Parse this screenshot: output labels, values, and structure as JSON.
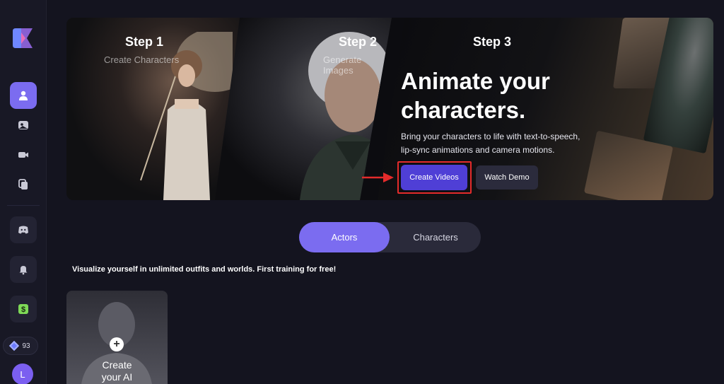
{
  "sidebar": {
    "credits": "93",
    "avatar_initial": "L",
    "items": [
      {
        "name": "actors-icon"
      },
      {
        "name": "images-icon"
      },
      {
        "name": "video-icon"
      },
      {
        "name": "copy-icon"
      },
      {
        "name": "discord-icon"
      },
      {
        "name": "bell-icon"
      },
      {
        "name": "dollar-icon"
      }
    ]
  },
  "hero": {
    "steps": [
      {
        "label": "Step 1",
        "sub": "Create Characters"
      },
      {
        "label": "Step 2",
        "sub": "Generate Images"
      },
      {
        "label": "Step 3",
        "sub": ""
      }
    ],
    "title_line1": "Animate your",
    "title_line2": "characters.",
    "desc_line1": "Bring your characters to life with text-to-speech,",
    "desc_line2": "lip-sync animations and camera motions.",
    "create_button": "Create Videos",
    "demo_button": "Watch Demo"
  },
  "tabs": {
    "actors": "Actors",
    "characters": "Characters"
  },
  "info_text": "Visualize yourself in unlimited outfits and worlds. First training for free!",
  "card": {
    "line1": "Create",
    "line2": "your AI"
  },
  "colors": {
    "accent": "#7b6cf0",
    "primary_button": "#4f3fd6",
    "highlight": "#e42b2b",
    "background": "#14141f"
  }
}
